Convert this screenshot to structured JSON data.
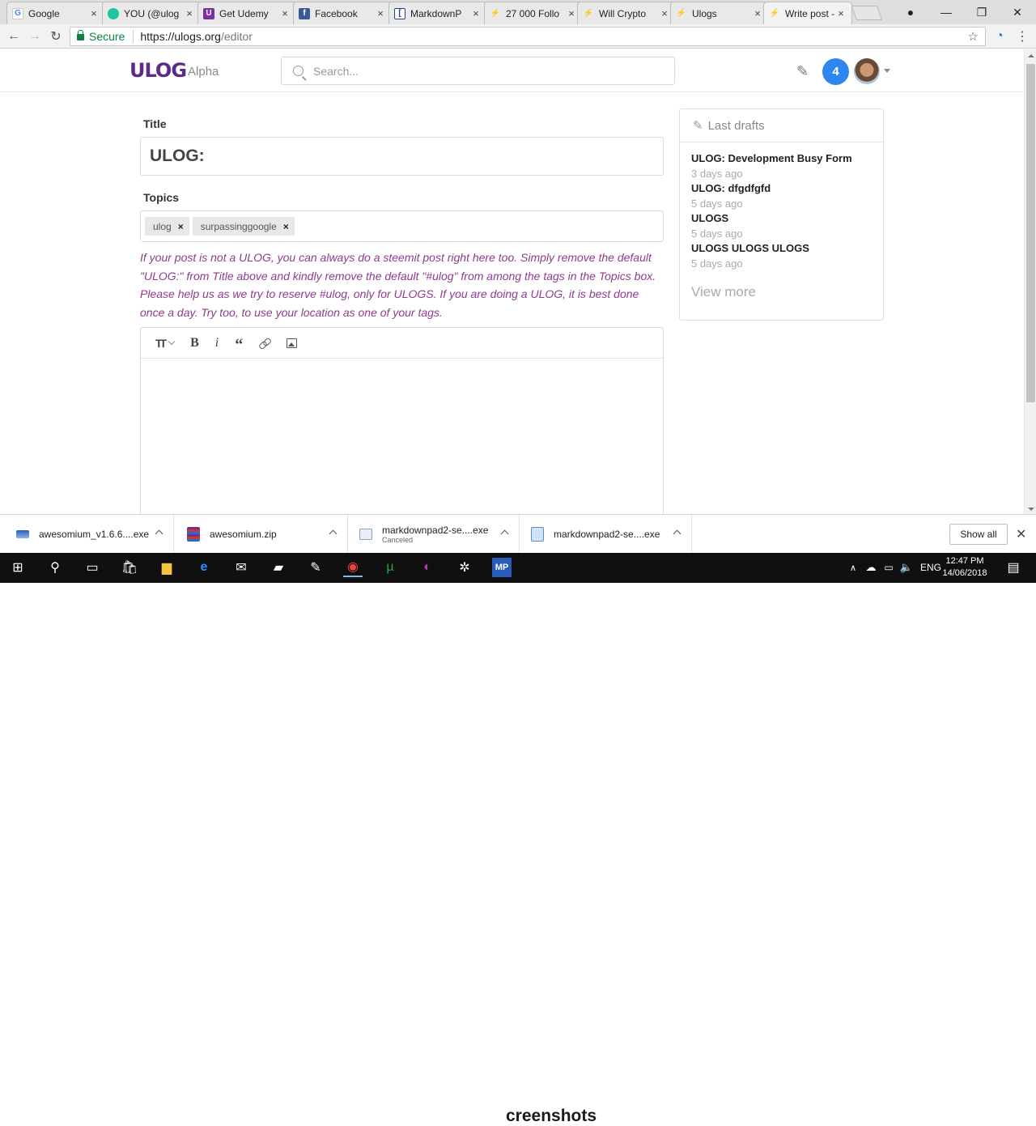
{
  "browser": {
    "tabs": [
      {
        "label": "Google",
        "icon": "google-icon",
        "color": "#4285f4"
      },
      {
        "label": "YOU (@ulog",
        "icon": "steemit-icon",
        "color": "#1ec6a0"
      },
      {
        "label": "Get Udemy",
        "icon": "udemy-icon",
        "color": "#7b2fa0"
      },
      {
        "label": "Facebook",
        "icon": "facebook-icon",
        "color": "#3b5998"
      },
      {
        "label": "MarkdownP",
        "icon": "markdownpad-icon",
        "color": "#2a3f8a"
      },
      {
        "label": "27 000 Follo",
        "icon": "bolt-icon",
        "color": "#333333"
      },
      {
        "label": "Will Crypto",
        "icon": "bolt-icon",
        "color": "#333333"
      },
      {
        "label": "Ulogs",
        "icon": "bolt-icon",
        "color": "#333333"
      },
      {
        "label": "Write post -",
        "icon": "bolt-icon",
        "color": "#333333"
      }
    ],
    "secure_label": "Secure",
    "url_host": "https://ulogs.org",
    "url_path": "/editor"
  },
  "header": {
    "logo_text": "ULOG",
    "logo_suffix": "Alpha",
    "search_placeholder": "Search...",
    "notification_count": "4"
  },
  "editor": {
    "title_label": "Title",
    "title_value": "ULOG:",
    "topics_label": "Topics",
    "tags": [
      "ulog",
      "surpassinggoogle"
    ],
    "notice": "If your post is not a ULOG, you can always do a steemit post right here too. Simply remove the default \"ULOG:\" from Title above and kindly remove the default \"#ulog\" from among the tags in the Topics box. Please help us as we try to reserve #ulog, only for ULOGS. If you are doing a ULOG, it is best done once a day. Try too, to use your location as one of your tags.",
    "toolbar": {
      "heading": "TT",
      "bold": "B",
      "italic": "i",
      "quote": "“"
    }
  },
  "drafts": {
    "heading": "Last drafts",
    "items": [
      {
        "title": "ULOG: Development Busy Form",
        "date": "3 days ago"
      },
      {
        "title": "ULOG: dfgdfgfd",
        "date": "5 days ago"
      },
      {
        "title": "ULOGS",
        "date": "5 days ago"
      },
      {
        "title": "ULOGS ULOGS ULOGS",
        "date": "5 days ago"
      }
    ],
    "view_more": "View more"
  },
  "downloads": {
    "items": [
      {
        "name": "awesomium_v1.6.6....exe",
        "sub": ""
      },
      {
        "name": "awesomium.zip",
        "sub": ""
      },
      {
        "name": "markdownpad2-se....exe",
        "sub": "Canceled"
      },
      {
        "name": "markdownpad2-se....exe",
        "sub": ""
      }
    ],
    "show_all": "Show all"
  },
  "taskbar": {
    "lang": "ENG",
    "time": "12:47 PM",
    "date": "14/06/2018",
    "watermark": "creenshots"
  }
}
